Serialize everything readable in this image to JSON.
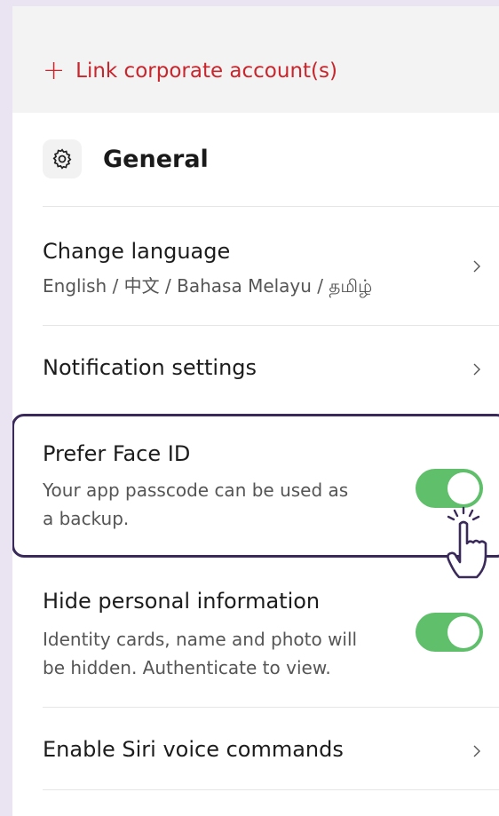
{
  "link_corporate": {
    "icon": "plus-icon",
    "label": "Link corporate account(s)",
    "color": "#c8252c"
  },
  "general": {
    "icon": "gear-icon",
    "title": "General"
  },
  "rows": {
    "language": {
      "title": "Change language",
      "subtitle": "English / 中文 / Bahasa Melayu / தமிழ்"
    },
    "notifications": {
      "title": "Notification settings"
    },
    "face_id": {
      "title": "Prefer Face ID",
      "subtitle_1": "Your app passcode can be used as",
      "subtitle_2": "a backup.",
      "enabled": true
    },
    "hide_info": {
      "title": "Hide personal information",
      "subtitle_1": "Identity cards, name and photo will",
      "subtitle_2": "be hidden. Authenticate to view.",
      "enabled": true
    },
    "siri": {
      "title": "Enable Siri voice commands"
    }
  },
  "colors": {
    "toggle_on": "#5fbf6a",
    "highlight_border": "#3a2a5a",
    "background": "#e9e3f2"
  }
}
